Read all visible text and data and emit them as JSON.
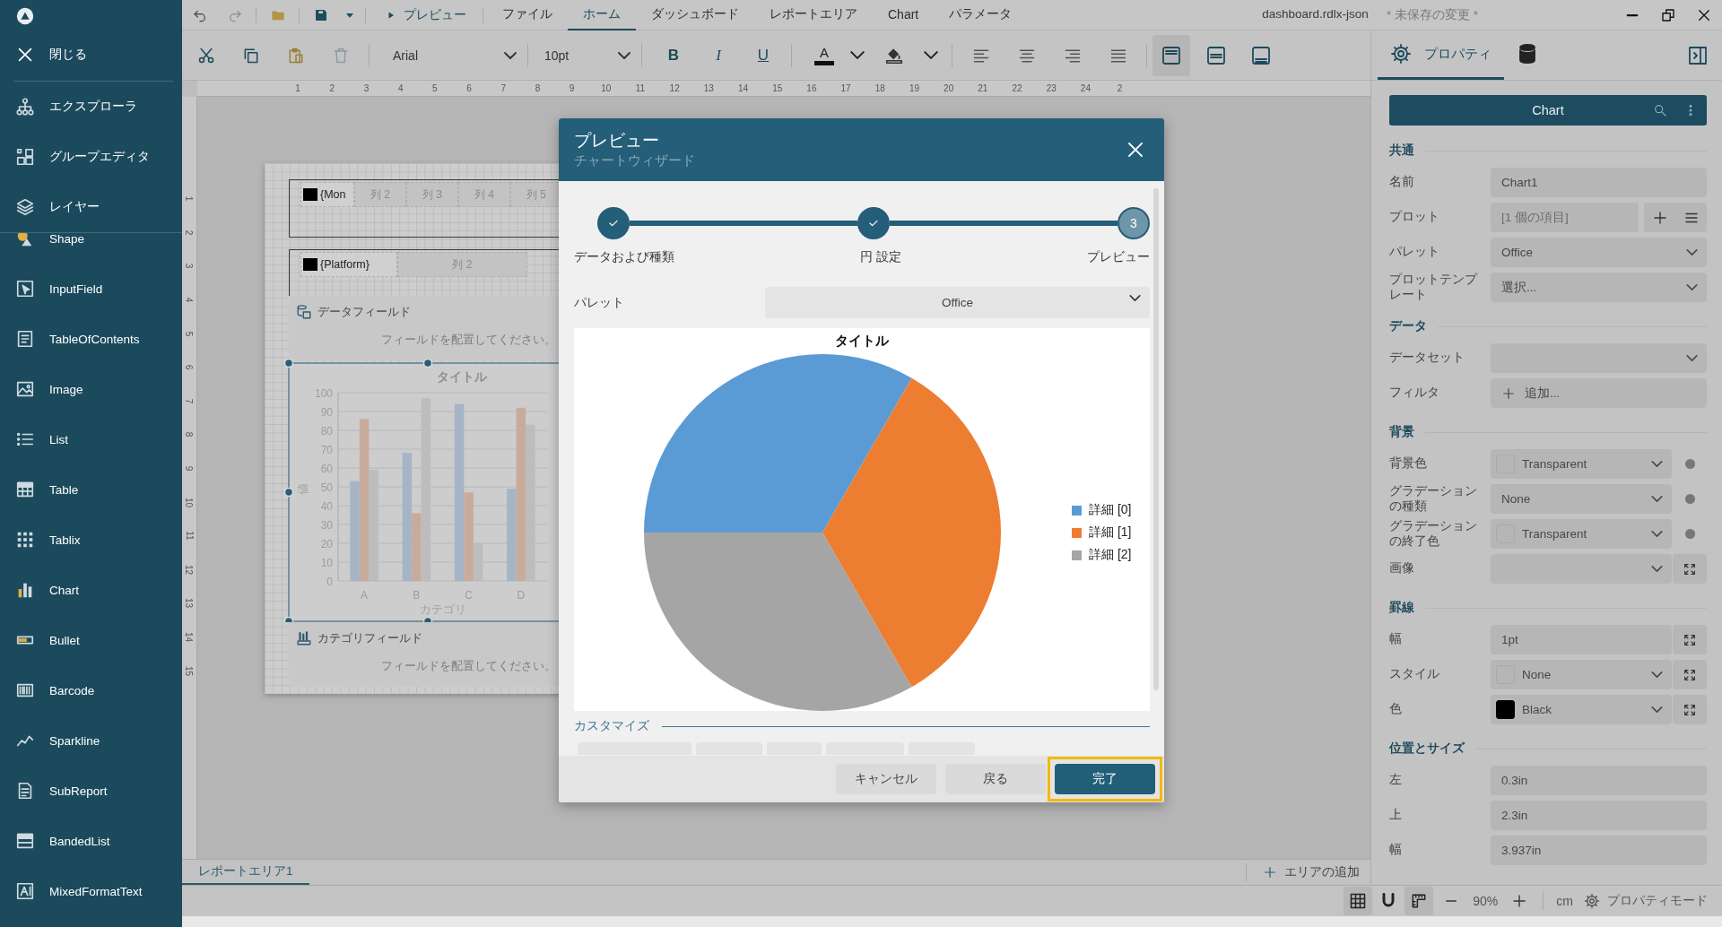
{
  "sidebar": {
    "close": "閉じる",
    "panels": [
      {
        "label": "エクスプローラ",
        "kind": "explorer"
      },
      {
        "label": "グループエディタ",
        "kind": "group"
      },
      {
        "label": "レイヤー",
        "kind": "layers"
      }
    ],
    "tools": [
      {
        "label": "Shape",
        "kind": "shape"
      },
      {
        "label": "InputField",
        "kind": "input"
      },
      {
        "label": "TableOfContents",
        "kind": "toc"
      },
      {
        "label": "Image",
        "kind": "image"
      },
      {
        "label": "List",
        "kind": "list"
      },
      {
        "label": "Table",
        "kind": "table"
      },
      {
        "label": "Tablix",
        "kind": "tablix"
      },
      {
        "label": "Chart",
        "kind": "chart"
      },
      {
        "label": "Bullet",
        "kind": "bullet"
      },
      {
        "label": "Barcode",
        "kind": "barcode"
      },
      {
        "label": "Sparkline",
        "kind": "sparkline"
      },
      {
        "label": "SubReport",
        "kind": "subreport"
      },
      {
        "label": "BandedList",
        "kind": "banded"
      },
      {
        "label": "MixedFormatText",
        "kind": "richtext"
      }
    ]
  },
  "menu_bar": {
    "preview": "プレビュー",
    "tabs": [
      {
        "label": "ファイル",
        "selected": false
      },
      {
        "label": "ホーム",
        "selected": true
      },
      {
        "label": "ダッシュボード",
        "selected": false
      },
      {
        "label": "レポートエリア",
        "selected": false
      },
      {
        "label": "Chart",
        "selected": false
      },
      {
        "label": "パラメータ",
        "selected": false
      }
    ]
  },
  "document": {
    "name": "dashboard.rdlx-json",
    "status": "* 未保存の変更 *"
  },
  "toolbar": {
    "font": "Arial",
    "font_size": "10pt",
    "bold": "B",
    "italic": "I",
    "underline": "U",
    "font_color": "A",
    "layouts": [
      {
        "kind": "top",
        "selected": true
      },
      {
        "kind": "middle",
        "selected": false
      },
      {
        "kind": "bottom",
        "selected": false
      }
    ]
  },
  "ruler": {
    "horizontal": [
      "1",
      "2",
      "3",
      "4",
      "5",
      "6",
      "7",
      "8",
      "9",
      "10",
      "11",
      "12",
      "13",
      "14",
      "15",
      "16",
      "17",
      "18",
      "19",
      "20",
      "21",
      "22",
      "23",
      "24",
      "2"
    ],
    "vertical": [
      "1",
      "2",
      "3",
      "4",
      "5",
      "6",
      "7",
      "8",
      "9",
      "10",
      "11",
      "12",
      "13",
      "14",
      "15"
    ]
  },
  "report": {
    "table_1": [
      "{Mon",
      "列 2",
      "列 3",
      "列 4",
      "列 5"
    ],
    "table_2": [
      "{Platform}",
      "列 2"
    ],
    "data_field": {
      "label": "データフィールド",
      "placeholder": "フィールドを配置してください。"
    },
    "chart": {
      "chart_data": {
        "type": "bar",
        "title": "タイトル",
        "xlabel": "カテゴリ",
        "ylabel": "値",
        "categories": [
          "A",
          "B",
          "C",
          "D"
        ],
        "series": [
          {
            "color": "#a5b5c5",
            "values": [
              53,
              68,
              94,
              49
            ]
          },
          {
            "color": "#c9ab9c",
            "values": [
              86,
              36,
              47,
              92
            ]
          },
          {
            "color": "#bdbdbd",
            "values": [
              59,
              97,
              20,
              83
            ]
          }
        ],
        "ylim": [
          0,
          100
        ],
        "grid": true,
        "yticks": [
          0,
          10,
          20,
          30,
          40,
          50,
          60,
          70,
          80,
          90,
          100
        ]
      }
    },
    "category_field": {
      "label": "カテゴリフィールド",
      "placeholder": "フィールドを配置してください。"
    }
  },
  "report_tabs": [
    {
      "label": "レポートエリア1",
      "selected": true
    }
  ],
  "add_area": "エリアの追加",
  "properties": {
    "tabs": [
      {
        "label": "プロパティ",
        "kind": "settings",
        "selected": true
      },
      {
        "kind": "data",
        "selected": false
      }
    ],
    "object": "Chart",
    "sections": [
      {
        "title": "共通",
        "rows": [
          {
            "label": "名前",
            "kind": "text",
            "value": "Chart1"
          },
          {
            "label": "プロット",
            "kind": "collection",
            "value": "[1 個の項目]"
          },
          {
            "label": "パレット",
            "kind": "select",
            "value": "Office"
          },
          {
            "label": "プロットテンプレート",
            "kind": "select",
            "value": "選択..."
          }
        ]
      },
      {
        "title": "データ",
        "rows": [
          {
            "label": "データセット",
            "kind": "select"
          },
          {
            "label": "フィルタ",
            "kind": "add",
            "value": "追加..."
          }
        ]
      },
      {
        "title": "背景",
        "rows": [
          {
            "label": "背景色",
            "kind": "select",
            "value": "Transparent",
            "swatch": {
              "filled": false
            },
            "trail": {
              "kind": "dot"
            }
          },
          {
            "label": "グラデーションの種類",
            "kind": "select",
            "value": "None",
            "trail": {
              "kind": "dot"
            }
          },
          {
            "label": "グラデーションの終了色",
            "kind": "select",
            "value": "Transparent",
            "swatch": {
              "filled": false
            },
            "trail": {
              "kind": "dot"
            }
          },
          {
            "label": "画像",
            "kind": "select",
            "trail": {
              "kind": "expand"
            }
          }
        ]
      },
      {
        "title": "罫線",
        "rows": [
          {
            "label": "幅",
            "kind": "text",
            "value": "1pt",
            "trail": {
              "kind": "expand"
            }
          },
          {
            "label": "スタイル",
            "kind": "select",
            "value": "None",
            "swatch": {
              "filled": false
            },
            "trail": {
              "kind": "expand"
            }
          },
          {
            "label": "色",
            "kind": "select",
            "value": "Black",
            "swatch": {
              "filled": true,
              "color": "#000000"
            },
            "trail": {
              "kind": "expand"
            }
          }
        ]
      },
      {
        "title": "位置とサイズ",
        "rows": [
          {
            "label": "左",
            "kind": "text",
            "value": "0.3in"
          },
          {
            "label": "上",
            "kind": "text",
            "value": "2.3in"
          },
          {
            "label": "幅",
            "kind": "text",
            "value": "3.937in"
          }
        ]
      }
    ]
  },
  "status_bar": {
    "toggles": [
      {
        "kind": "grid",
        "on": true
      },
      {
        "kind": "snap",
        "on": false
      },
      {
        "kind": "ruler",
        "on": true
      }
    ],
    "zoom": "90%",
    "unit": "cm",
    "mode": "プロパティモード"
  },
  "dialog": {
    "title": "プレビュー",
    "subtitle": "チャートウィザード",
    "steps": [
      {
        "label": "データおよび種類",
        "done": true
      },
      {
        "label": "円 設定",
        "done": true
      },
      {
        "label": "プレビュー",
        "done": false,
        "number": "3"
      }
    ],
    "palette": {
      "label": "パレット",
      "value": "Office"
    },
    "pie": {
      "title": "タイトル",
      "legend": [
        {
          "label": "詳細 [0]",
          "color": "#5b9bd5"
        },
        {
          "label": "詳細 [1]",
          "color": "#ed7d31"
        },
        {
          "label": "詳細 [2]",
          "color": "#a5a5a5"
        }
      ]
    },
    "customize": "カスタマイズ",
    "buttons": [
      {
        "label": "キャンセル",
        "kind": "secondary",
        "focused": false
      },
      {
        "label": "戻る",
        "kind": "secondary",
        "focused": false
      },
      {
        "label": "完了",
        "kind": "primary",
        "focused": true
      }
    ]
  }
}
